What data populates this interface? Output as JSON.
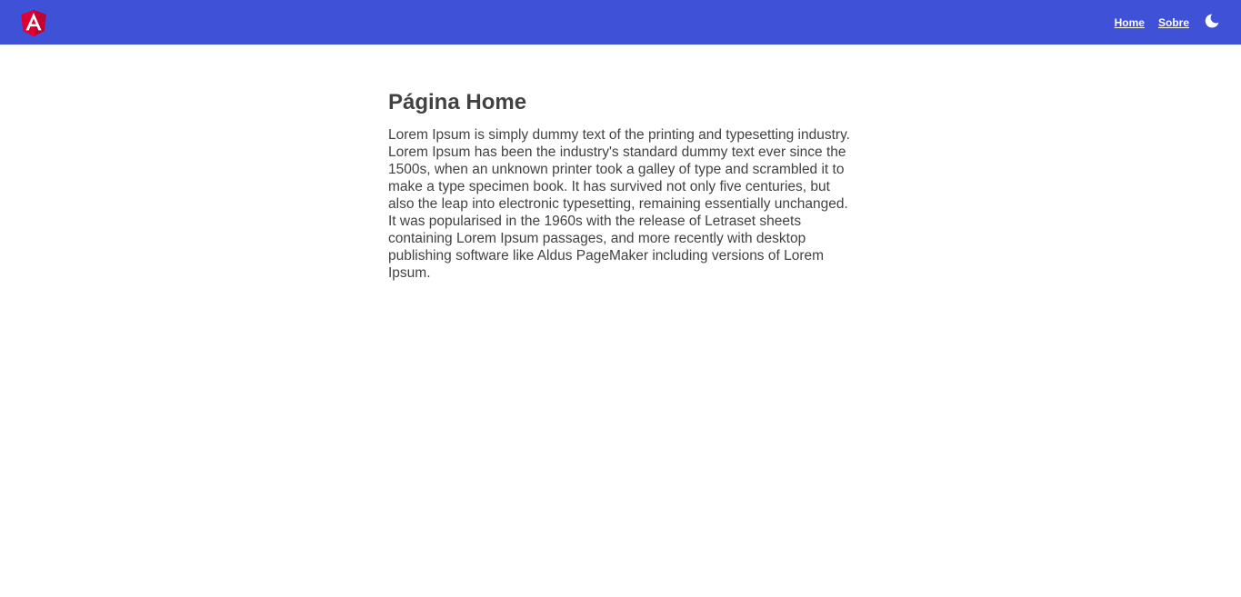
{
  "header": {
    "logo_icon": "angular-logo-icon",
    "brand_color": "#3f51d6",
    "nav": [
      {
        "label": "Home"
      },
      {
        "label": "Sobre"
      }
    ],
    "theme_toggle_icon": "moon-icon"
  },
  "main": {
    "title": "Página Home",
    "body": "Lorem Ipsum is simply dummy text of the printing and typesetting industry. Lorem Ipsum has been the industry's standard dummy text ever since the 1500s, when an unknown printer took a galley of type and scrambled it to make a type specimen book. It has survived not only five centuries, but also the leap into electronic typesetting, remaining essentially unchanged. It was popularised in the 1960s with the release of Letraset sheets containing Lorem Ipsum passages, and more recently with desktop publishing software like Aldus PageMaker including versions of Lorem Ipsum."
  }
}
